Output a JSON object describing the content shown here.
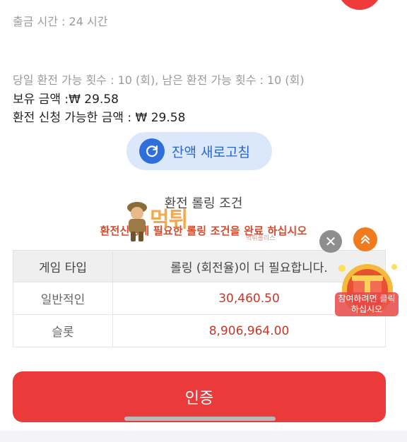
{
  "withdraw_time": {
    "text": "출금 시간 :  24 시간"
  },
  "limits": {
    "text": "당일 환전 가능 횟수 : 10 (회), 남은 환전 가능 횟수 : 10 (회)"
  },
  "balance": {
    "text": "보유 금액 :₩ 29.58"
  },
  "withdrawable": {
    "text": "환전 신청 가능한 금액 : ₩ 29.58"
  },
  "refresh_button": {
    "label": "잔액 새로고침",
    "icon": "refresh-icon"
  },
  "rolling": {
    "title": "환전 롤링 조건",
    "warning": "환전신청에 필요한 롤링 조건을 완료 하십시오",
    "headers": [
      "게임 타입",
      "롤링 (회전율)이 더 필요합니다."
    ],
    "rows": [
      {
        "type": "일반적인",
        "value": "30,460.50"
      },
      {
        "type": "슬롯",
        "value": "8,906,964.00"
      }
    ]
  },
  "overlay": {
    "watermark": "먹튀",
    "watermark_sub": "먹튀폴리스",
    "gift_text": "참여하려면 클릭하십시오",
    "close_icon": "close-icon",
    "up_icon": "double-chevron-up-icon"
  },
  "confirm_button": {
    "label": "인증"
  },
  "colors": {
    "accent_red": "#ea3a3a",
    "refresh_bg": "#dbe8fb",
    "refresh_icon": "#2f6fdc",
    "warning": "#d44a2c"
  }
}
